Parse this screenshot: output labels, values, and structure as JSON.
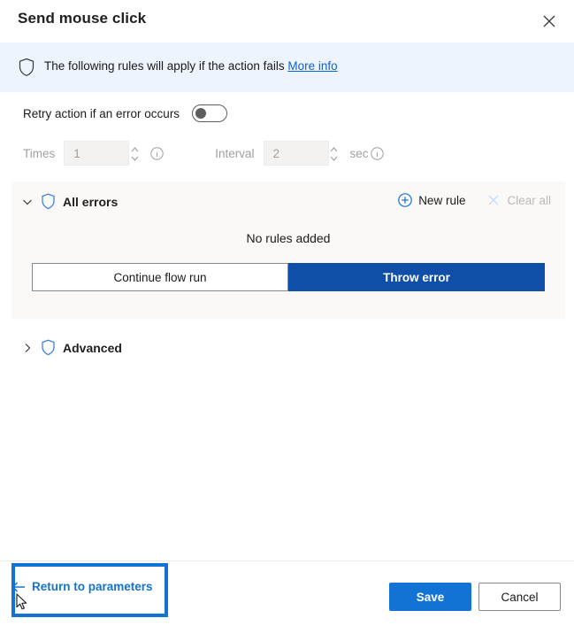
{
  "dialog": {
    "title": "Send mouse click",
    "close_icon": "close-icon"
  },
  "banner": {
    "shield_icon": "shield-icon",
    "text": "The following rules will apply if the action fails",
    "link_label": "More info"
  },
  "retry": {
    "label": "Retry action if an error occurs",
    "toggle_state": "off",
    "times_label": "Times",
    "times_value": "1",
    "times_info_icon": "info-icon",
    "interval_label": "Interval",
    "interval_value": "2",
    "seconds_label": "sec",
    "interval_info_icon": "info-icon",
    "spinner_icon": "chevron-up-down-icon"
  },
  "rules_panel": {
    "expand_icon": "chevron-down-icon",
    "shield_icon": "shield-icon",
    "title": "All errors",
    "new_rule_label": "New rule",
    "new_rule_icon": "circle-plus-icon",
    "clear_all_label": "Clear all",
    "clear_all_icon": "close-x-icon",
    "empty_state": "No rules added",
    "segmented": {
      "options": [
        {
          "label": "Continue flow run",
          "selected": false
        },
        {
          "label": "Throw error",
          "selected": true
        }
      ]
    }
  },
  "advanced": {
    "expand_icon": "chevron-right-icon",
    "shield_icon": "shield-icon",
    "title": "Advanced"
  },
  "footer": {
    "return_label": "Return to parameters",
    "return_icon": "arrow-left-icon",
    "save_label": "Save",
    "cancel_label": "Cancel",
    "cursor_icon": "mouse-pointer-icon"
  },
  "colors": {
    "accent_blue": "#1273d4",
    "selected_segment_blue": "#0f4fa8",
    "banner_background": "#eef4fd",
    "panel_background": "#faf9f8",
    "highlight_border": "#1273d4",
    "disabled_text": "#bcbab8"
  }
}
